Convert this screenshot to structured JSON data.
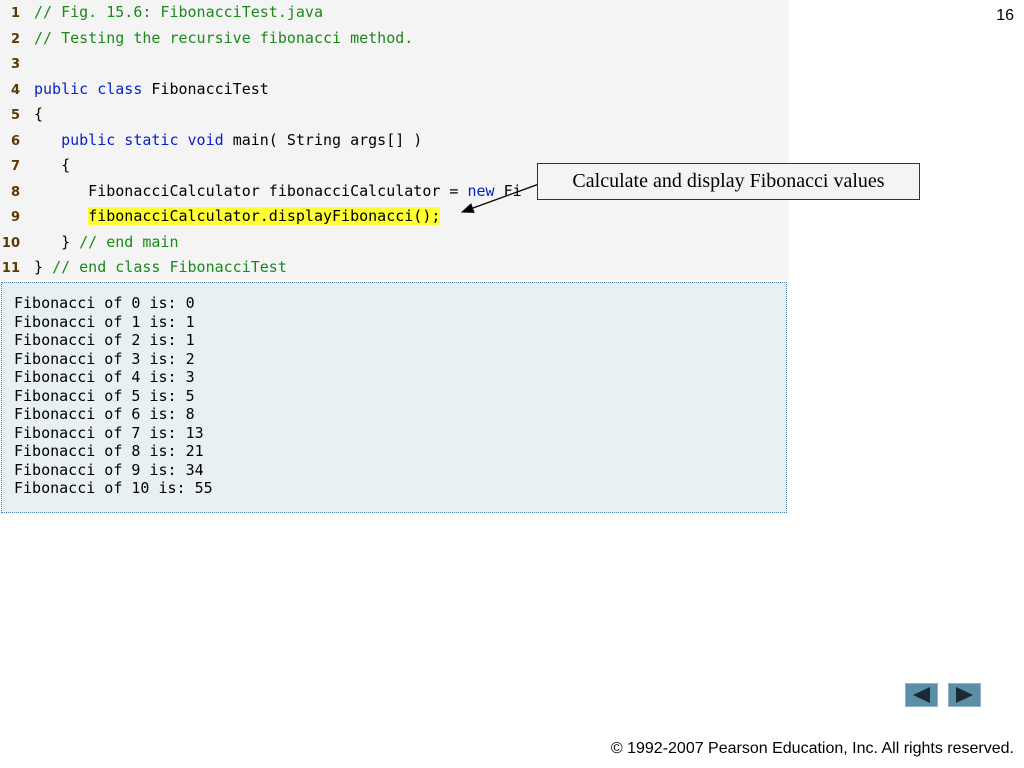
{
  "page": {
    "number": "16",
    "copyright": "© 1992-2007 Pearson Education, Inc.  All rights reserved."
  },
  "code": {
    "lines": [
      {
        "num": "1",
        "segments": [
          {
            "cls": "comment",
            "text": "// Fig. 15.6: FibonacciTest.java"
          }
        ]
      },
      {
        "num": "2",
        "segments": [
          {
            "cls": "comment",
            "text": "// Testing the recursive fibonacci method."
          }
        ]
      },
      {
        "num": "3",
        "segments": []
      },
      {
        "num": "4",
        "segments": [
          {
            "cls": "kw",
            "text": "public class "
          },
          {
            "cls": "plain",
            "text": "FibonacciTest"
          }
        ]
      },
      {
        "num": "5",
        "segments": [
          {
            "cls": "plain",
            "text": "{"
          }
        ]
      },
      {
        "num": "6",
        "segments": [
          {
            "cls": "plain",
            "text": "   "
          },
          {
            "cls": "kw",
            "text": "public static void "
          },
          {
            "cls": "plain",
            "text": "main( String args[] )"
          }
        ]
      },
      {
        "num": "7",
        "segments": [
          {
            "cls": "plain",
            "text": "   {"
          }
        ]
      },
      {
        "num": "8",
        "segments": [
          {
            "cls": "plain",
            "text": "      FibonacciCalculator fibonacciCalculator = "
          },
          {
            "cls": "kw",
            "text": "new "
          },
          {
            "cls": "plain",
            "text": "Fi"
          }
        ]
      },
      {
        "num": "9",
        "segments": [
          {
            "cls": "plain",
            "text": "      "
          },
          {
            "cls": "plain hl",
            "text": "fibonacciCalculator.displayFibonacci();"
          }
        ]
      },
      {
        "num": "10",
        "segments": [
          {
            "cls": "plain",
            "text": "   } "
          },
          {
            "cls": "comment",
            "text": "// end main"
          }
        ]
      },
      {
        "num": "11",
        "segments": [
          {
            "cls": "plain",
            "text": "} "
          },
          {
            "cls": "comment",
            "text": "// end class FibonacciTest"
          }
        ]
      }
    ]
  },
  "callout": {
    "text": "Calculate and display Fibonacci values"
  },
  "output": {
    "lines": [
      "Fibonacci of 0 is: 0",
      "Fibonacci of 1 is: 1",
      "Fibonacci of 2 is: 1",
      "Fibonacci of 3 is: 2",
      "Fibonacci of 4 is: 3",
      "Fibonacci of 5 is: 5",
      "Fibonacci of 6 is: 8",
      "Fibonacci of 7 is: 13",
      "Fibonacci of 8 is: 21",
      "Fibonacci of 9 is: 34",
      "Fibonacci of 10 is: 55"
    ]
  },
  "navigation": {
    "prev_icon": "triangle-left-icon",
    "next_icon": "triangle-right-icon",
    "button_color": "#5c8ea8"
  }
}
